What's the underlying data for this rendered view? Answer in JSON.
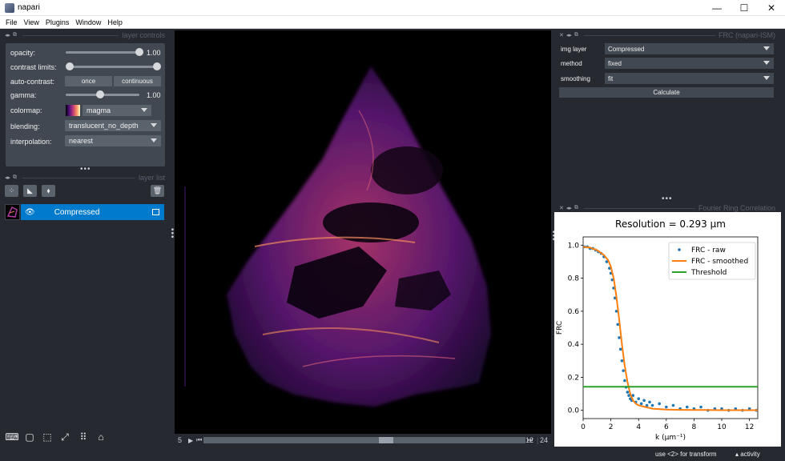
{
  "window": {
    "title": "napari",
    "minimize": "—",
    "maximize": "☐",
    "close": "✕"
  },
  "menu": [
    "File",
    "View",
    "Plugins",
    "Window",
    "Help"
  ],
  "layer_controls": {
    "title": "layer controls",
    "opacity_label": "opacity:",
    "opacity_value": "1.00",
    "contrast_label": "contrast limits:",
    "auto_contrast_label": "auto-contrast:",
    "once_label": "once",
    "continuous_label": "continuous",
    "gamma_label": "gamma:",
    "gamma_value": "1.00",
    "colormap_label": "colormap:",
    "colormap_value": "magma",
    "blending_label": "blending:",
    "blending_value": "translucent_no_depth",
    "interpolation_label": "interpolation:",
    "interpolation_value": "nearest"
  },
  "layer_list": {
    "title": "layer list",
    "layers": [
      {
        "name": "Compressed",
        "visible": true
      }
    ]
  },
  "dims": {
    "play_value": "5",
    "current": "12",
    "total": "24"
  },
  "frc_panel": {
    "title": "FRC (napari-ISM)",
    "img_layer_label": "img layer",
    "img_layer_value": "Compressed",
    "method_label": "method",
    "method_value": "fixed",
    "smoothing_label": "smoothing",
    "smoothing_value": "fit",
    "calculate_label": "Calculate"
  },
  "plot_panel": {
    "title": "Fourier Ring Correlation"
  },
  "status": {
    "hint": "use <2> for transform",
    "activity": "activity"
  },
  "chart_data": {
    "type": "line",
    "title": "Resolution = 0.293 µm",
    "xlabel": "k (µm⁻¹)",
    "ylabel": "FRC",
    "xlim": [
      0,
      12.6
    ],
    "ylim": [
      -0.05,
      1.05
    ],
    "xticks": [
      0,
      2,
      4,
      6,
      8,
      10,
      12
    ],
    "yticks": [
      0.0,
      0.2,
      0.4,
      0.6,
      0.8,
      1.0
    ],
    "legend_position": "top-right",
    "series": [
      {
        "name": "FRC - raw",
        "kind": "scatter",
        "color": "#1f77b4",
        "x": [
          0.1,
          0.3,
          0.5,
          0.7,
          0.9,
          1.1,
          1.3,
          1.5,
          1.7,
          1.9,
          2.0,
          2.1,
          2.2,
          2.3,
          2.4,
          2.5,
          2.6,
          2.7,
          2.8,
          2.9,
          3.0,
          3.1,
          3.2,
          3.3,
          3.4,
          3.5,
          3.6,
          3.8,
          4.0,
          4.2,
          4.4,
          4.6,
          4.8,
          5.0,
          5.5,
          6.0,
          6.5,
          7.0,
          7.5,
          8.0,
          8.5,
          9.0,
          9.5,
          10.0,
          10.5,
          11.0,
          11.5,
          12.0,
          12.5
        ],
        "y": [
          0.99,
          0.99,
          0.98,
          0.98,
          0.97,
          0.96,
          0.95,
          0.93,
          0.9,
          0.86,
          0.83,
          0.79,
          0.74,
          0.68,
          0.6,
          0.52,
          0.44,
          0.37,
          0.3,
          0.24,
          0.18,
          0.14,
          0.11,
          0.09,
          0.07,
          0.06,
          0.09,
          0.05,
          0.07,
          0.04,
          0.06,
          0.03,
          0.05,
          0.03,
          0.04,
          0.02,
          0.03,
          0.01,
          0.02,
          0.01,
          0.02,
          0.0,
          0.01,
          0.01,
          0.0,
          0.01,
          0.0,
          0.01,
          0.0
        ]
      },
      {
        "name": "FRC - smoothed",
        "kind": "line",
        "color": "#ff7f0e",
        "x": [
          0,
          0.5,
          1.0,
          1.5,
          1.8,
          2.0,
          2.2,
          2.4,
          2.6,
          2.8,
          3.0,
          3.2,
          3.4,
          3.6,
          3.8,
          4.0,
          4.5,
          5,
          6,
          7,
          8,
          9,
          10,
          11,
          12,
          12.6
        ],
        "y": [
          0.99,
          0.985,
          0.97,
          0.94,
          0.91,
          0.87,
          0.8,
          0.69,
          0.55,
          0.4,
          0.27,
          0.17,
          0.1,
          0.06,
          0.04,
          0.03,
          0.02,
          0.01,
          0.005,
          0.003,
          0.002,
          0.002,
          0.001,
          0.001,
          0.001,
          0.001
        ]
      },
      {
        "name": "Threshold",
        "kind": "line",
        "color": "#2ca02c",
        "x": [
          0,
          12.6
        ],
        "y": [
          0.143,
          0.143
        ]
      }
    ]
  }
}
